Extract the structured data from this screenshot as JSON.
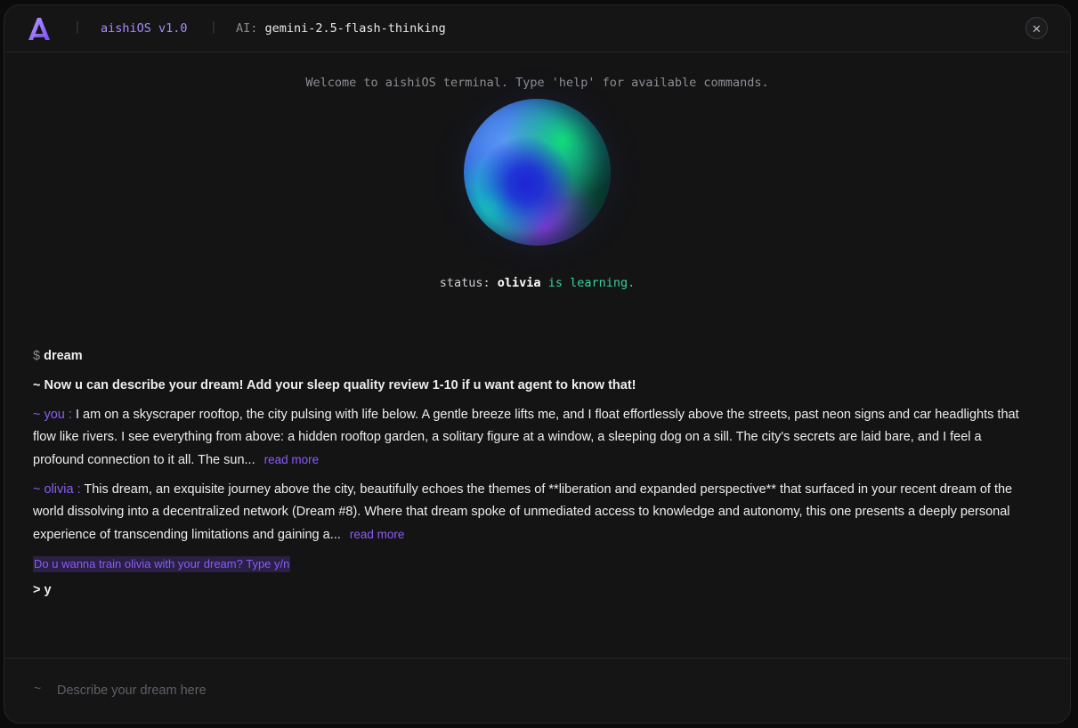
{
  "header": {
    "app_name": "aishiOS v1.0",
    "ai_label": "AI:",
    "ai_model": "gemini-2.5-flash-thinking",
    "separator": "|",
    "close_glyph": "✕"
  },
  "main": {
    "welcome": "Welcome to aishiOS terminal. Type 'help' for available commands.",
    "status_label": "status:",
    "agent_name": "olivia",
    "status_text": "is learning."
  },
  "log": {
    "command_prompt": "$",
    "command": "dream",
    "instruction": "~ Now u can describe your dream! Add your sleep quality review 1-10 if u want agent to know that!",
    "user_prefix": "~ you :",
    "user_message": "I am on a skyscraper rooftop, the city pulsing with life below. A gentle breeze lifts me, and I float effortlessly above the streets, past neon signs and car headlights that flow like rivers. I see everything from above: a hidden rooftop garden, a solitary figure at a window, a sleeping dog on a sill. The city's secrets are laid bare, and I feel a profound connection to it all. The sun...",
    "agent_prefix": "~ olivia :",
    "agent_message": "This dream, an exquisite journey above the city, beautifully echoes the themes of **liberation and expanded perspective** that surfaced in your recent dream of the world dissolving into a decentralized network (Dream #8). Where that dream spoke of unmediated access to knowledge and autonomy, this one presents a deeply personal experience of transcending limitations and gaining a...",
    "read_more": "read more",
    "train_prompt": "Do u wanna train olivia with your dream? Type y/n",
    "answer": "> y"
  },
  "footer": {
    "tilde": "~",
    "placeholder": "Describe your dream here"
  },
  "colors": {
    "accent": "#8b5cf6",
    "status_green": "#34d399",
    "background": "#141415"
  },
  "icons": {
    "logo": "aishi-logo-icon",
    "close": "close-icon"
  }
}
